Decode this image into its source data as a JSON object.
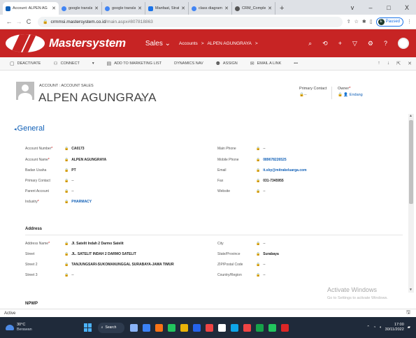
{
  "browser": {
    "tabs": [
      {
        "title": "Account: ALPEN AG",
        "color": "#1160b7",
        "active": true
      },
      {
        "title": "google translate -",
        "color": "#4285f4"
      },
      {
        "title": "google translate -",
        "color": "#4285f4"
      },
      {
        "title": "Manfaat, Strategi,",
        "color": "#1a73e8"
      },
      {
        "title": "class diagram crm",
        "color": "#4285f4"
      },
      {
        "title": "CRM_Complete_Fi",
        "color": "#555555"
      }
    ],
    "new_tab": "+",
    "window_controls": [
      "v",
      "–",
      "□",
      "X"
    ],
    "url_host": "crmmsi.mastersystem.co.id",
    "url_path": "/main.aspx#807818863",
    "paused_label": "Paused",
    "paused_initial": "E"
  },
  "app": {
    "brand": "Mastersystem",
    "area": "Sales",
    "breadcrumb": [
      "Accounts",
      ">",
      "ALPEN AGUNGRAYA",
      ">"
    ],
    "header_icons": [
      "search-icon",
      "history-icon",
      "plus-icon",
      "filter-icon",
      "gear-icon",
      "help-icon"
    ]
  },
  "commands": [
    {
      "icon": "deactivate-icon",
      "label": "DEACTIVATE"
    },
    {
      "icon": "connect-icon",
      "label": "CONNECT"
    },
    {
      "icon": "chevron-down-icon",
      "label": "▾"
    },
    {
      "icon": "marketing-list-icon",
      "label": "ADD TO MARKETING LIST"
    },
    {
      "icon": "",
      "label": "DYNAMICS NAV"
    },
    {
      "icon": "assign-icon",
      "label": "ASSIGN"
    },
    {
      "icon": "email-icon",
      "label": "EMAIL A LINK"
    },
    {
      "icon": "more-icon",
      "label": "•••"
    }
  ],
  "record": {
    "entity": "ACCOUNT : ACCOUNT SALES",
    "title": "ALPEN AGUNGRAYA",
    "primary_contact_label": "Primary Contact",
    "primary_contact_value": "--",
    "owner_label": "Owner",
    "owner_value": "Endang"
  },
  "general": {
    "title": "General",
    "left": [
      {
        "label": "Account Number",
        "required": true,
        "value": "CA0173"
      },
      {
        "label": "Account Name",
        "required": true,
        "value": "ALPEN AGUNGRAYA"
      },
      {
        "label": "Badan Usaha",
        "required": false,
        "value": "PT"
      },
      {
        "label": "Primary Contact",
        "required": false,
        "value": "--"
      },
      {
        "label": "Parent Account",
        "required": false,
        "value": "--"
      },
      {
        "label": "Industry",
        "required": true,
        "value": "PHARMACY"
      }
    ],
    "right": [
      {
        "label": "Main Phone",
        "value": "--"
      },
      {
        "label": "Mobile Phone",
        "value": "089678226525"
      },
      {
        "label": "Email",
        "value": "it.sby@mitrakeluarga.com"
      },
      {
        "label": "Fax",
        "value": "031-7345955"
      },
      {
        "label": "Website",
        "value": "--"
      }
    ]
  },
  "address": {
    "title": "Address",
    "left": [
      {
        "label": "Address Name",
        "required": true,
        "value": "Jl. Satelit Indah 2 Darmo Satelit"
      },
      {
        "label": "Street",
        "required": false,
        "value": "JL. SATELIT INDAH 2 DARMO SATELIT"
      },
      {
        "label": "Street 2",
        "required": false,
        "value": "TANJUNGSARI-SUKOMANUNGGAL SURABAYA-JAWA TIMUR"
      },
      {
        "label": "Street 3",
        "required": false,
        "value": "--"
      }
    ],
    "right": [
      {
        "label": "City",
        "value": "--"
      },
      {
        "label": "State/Province",
        "value": "Surabaya"
      },
      {
        "label": "ZIP/Postal Code",
        "value": "--"
      },
      {
        "label": "Country/Region",
        "value": "--"
      }
    ]
  },
  "npwp_title": "NPWP",
  "watermark": {
    "line1": "Activate Windows",
    "line2": "Go to Settings to activate Windows."
  },
  "status": "Active",
  "taskbar": {
    "temp": "30°C",
    "weather": "Berawan",
    "search": "Search",
    "time": "17:00",
    "date": "30/11/2022",
    "app_colors": [
      "#8ab4f8",
      "#3b82f6",
      "#f97316",
      "#22c55e",
      "#eab308",
      "#2563eb",
      "#ef4444",
      "#ffffff",
      "#0ea5e9",
      "#ef4444",
      "#16a34a",
      "#22c55e",
      "#dc2626"
    ]
  }
}
